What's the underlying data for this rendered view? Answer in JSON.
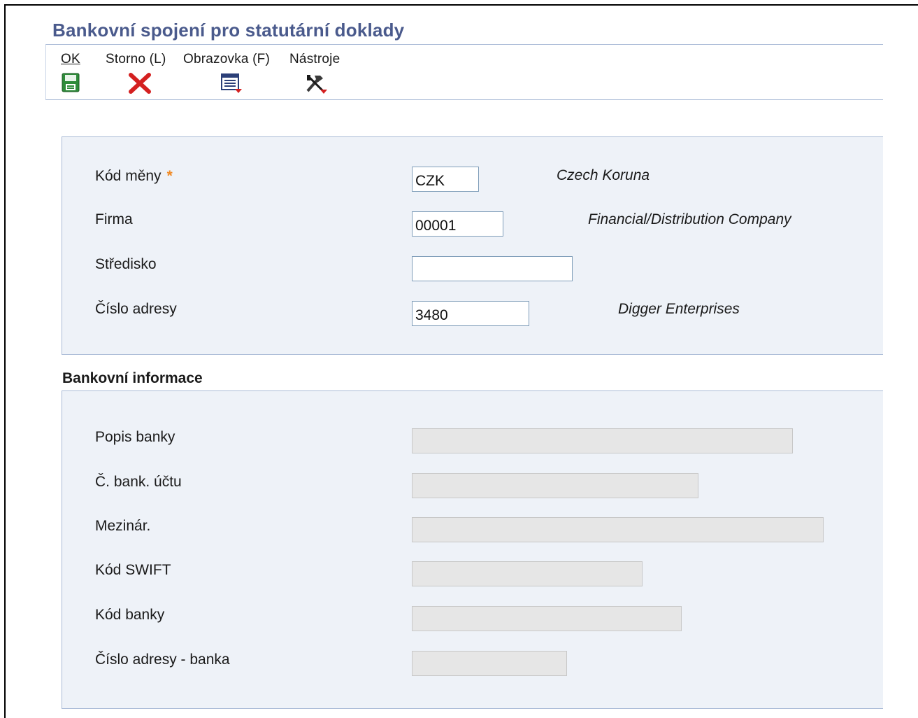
{
  "page": {
    "title": "Bankovní spojení pro statutární doklady"
  },
  "toolbar": {
    "ok_label": "OK",
    "cancel_label": "Storno (L)",
    "form_label": "Obrazovka (F)",
    "tools_label": "Nástroje",
    "ok_icon": "save-icon",
    "cancel_icon": "close-x-icon",
    "form_icon": "form-menu-icon",
    "tools_icon": "tools-menu-icon"
  },
  "header": {
    "currency": {
      "label": "Kód měny",
      "required_mark": "*",
      "value": "CZK",
      "description": "Czech Koruna"
    },
    "company": {
      "label": "Firma",
      "value": "00001",
      "description": "Financial/Distribution Company"
    },
    "business_unit": {
      "label": "Středisko",
      "value": ""
    },
    "address_number": {
      "label": "Číslo adresy",
      "value": "3480",
      "description": "Digger Enterprises"
    }
  },
  "bank_info": {
    "section_title": "Bankovní informace",
    "fields": [
      {
        "label": "Popis banky",
        "value": ""
      },
      {
        "label": "Č. bank. účtu",
        "value": ""
      },
      {
        "label": "Mezinár.",
        "value": ""
      },
      {
        "label": "Kód SWIFT",
        "value": ""
      },
      {
        "label": "Kód banky",
        "value": ""
      },
      {
        "label": "Číslo adresy - banka",
        "value": ""
      }
    ]
  },
  "colors": {
    "title": "#4a5a8c",
    "panel_bg": "#eef2f8",
    "panel_border": "#a9bad6",
    "required": "#f08a24",
    "cancel_x": "#d42020",
    "readonly_bg": "#e6e6e6"
  }
}
